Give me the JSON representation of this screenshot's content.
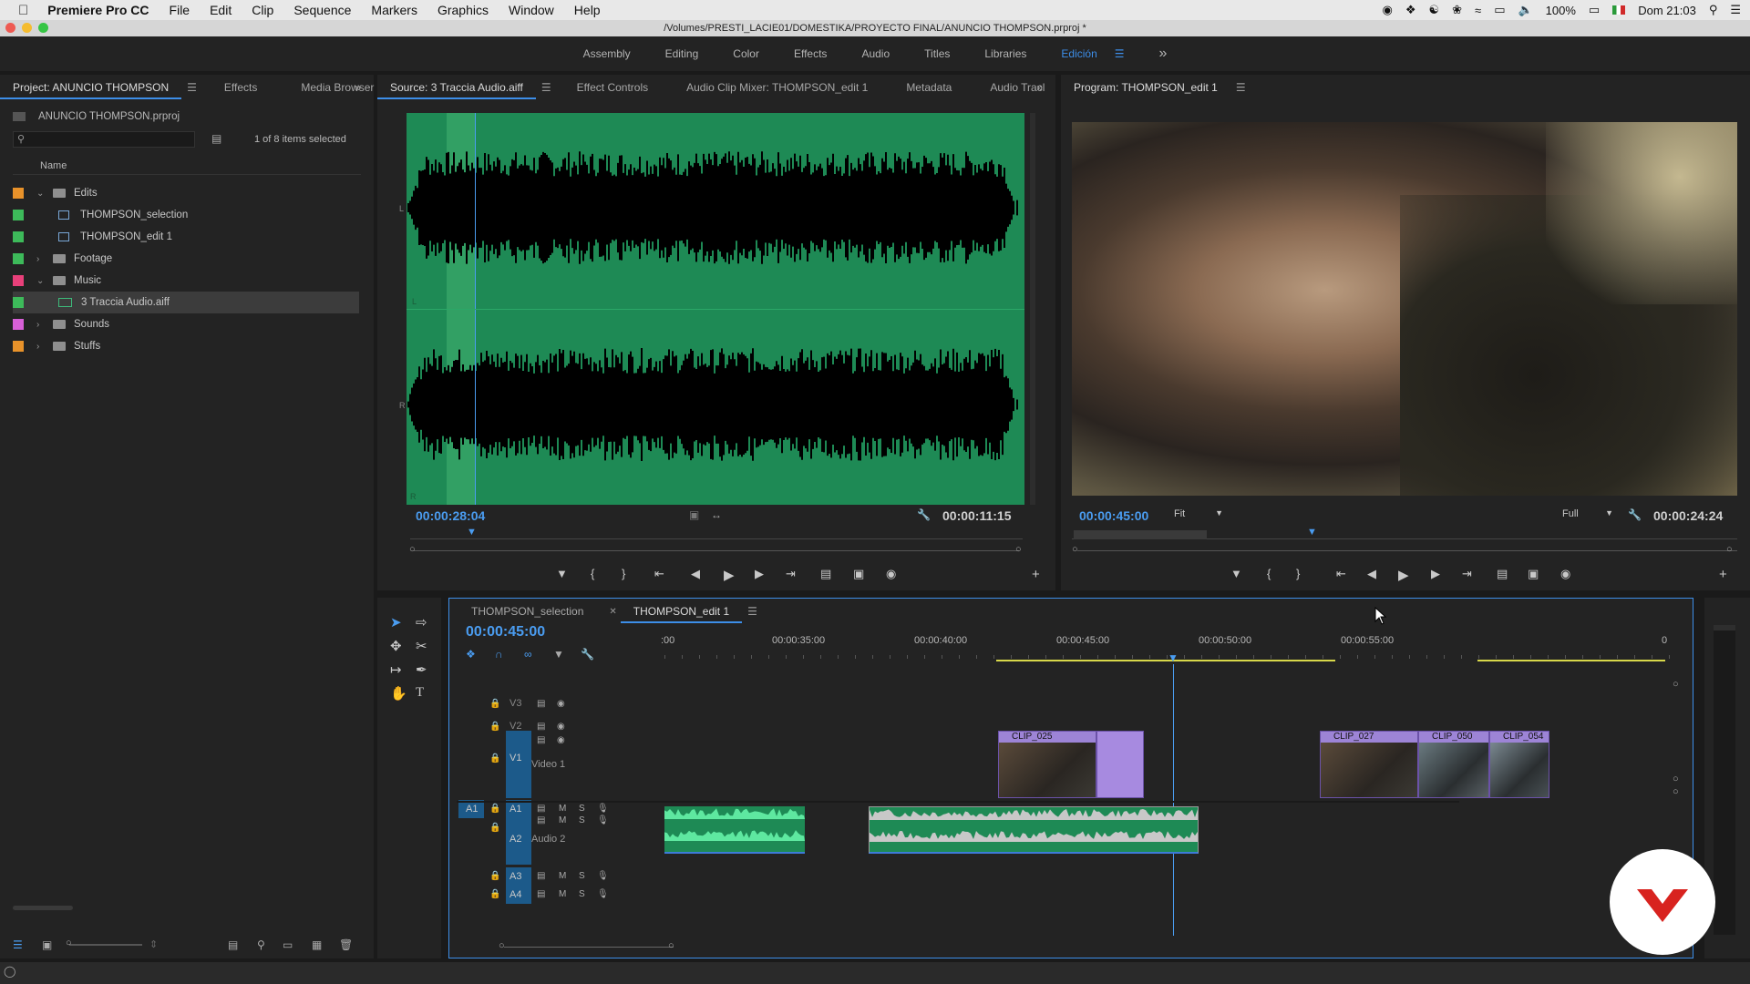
{
  "menubar": {
    "app_name": "Premiere Pro CC",
    "items": [
      "File",
      "Edit",
      "Clip",
      "Sequence",
      "Markers",
      "Graphics",
      "Window",
      "Help"
    ],
    "battery": "100%",
    "clock": "Dom 21:03"
  },
  "window": {
    "title": "/Volumes/PRESTI_LACIE01/DOMESTIKA/PROYECTO FINAL/ANUNCIO THOMPSON.prproj *"
  },
  "workspaces": {
    "items": [
      "Assembly",
      "Editing",
      "Color",
      "Effects",
      "Audio",
      "Titles",
      "Libraries",
      "Edición"
    ],
    "active": "Edición",
    "overflow": "»"
  },
  "project_panel": {
    "tabs": [
      "Project: ANUNCIO THOMPSON",
      "Effects",
      "Media Browser"
    ],
    "project_file": "ANUNCIO THOMPSON.prproj",
    "selection_status": "1 of 8 items selected",
    "column_name": "Name",
    "items": [
      {
        "label": "Edits",
        "type": "folder",
        "expanded": true,
        "color": "#e8922a",
        "indent": 0
      },
      {
        "label": "THOMPSON_selection",
        "type": "sequence",
        "color": "#3dba5a",
        "indent": 1
      },
      {
        "label": "THOMPSON_edit 1",
        "type": "sequence",
        "color": "#3dba5a",
        "indent": 1
      },
      {
        "label": "Footage",
        "type": "folder",
        "expanded": false,
        "color": "#3dba5a",
        "indent": 0
      },
      {
        "label": "Music",
        "type": "folder",
        "expanded": true,
        "color": "#e8407a",
        "indent": 0
      },
      {
        "label": "3 Traccia Audio.aiff",
        "type": "audio",
        "color": "#3dba5a",
        "indent": 1,
        "selected": true
      },
      {
        "label": "Sounds",
        "type": "folder",
        "expanded": false,
        "color": "#d860d8",
        "indent": 0
      },
      {
        "label": "Stuffs",
        "type": "folder",
        "expanded": false,
        "color": "#e8922a",
        "indent": 0
      }
    ]
  },
  "source_panel": {
    "tabs": [
      "Source: 3 Traccia Audio.aiff",
      "Effect Controls",
      "Audio Clip Mixer: THOMPSON_edit 1",
      "Metadata",
      "Audio Tracl"
    ],
    "timecode_current": "00:00:28:04",
    "timecode_duration": "00:00:11:15",
    "channel_labels": [
      "L",
      "L",
      "R",
      "R"
    ]
  },
  "program_panel": {
    "tab": "Program: THOMPSON_edit 1",
    "timecode_current": "00:00:45:00",
    "zoom": "Fit",
    "resolution": "Full",
    "timecode_duration": "00:00:24:24"
  },
  "timeline": {
    "tabs": [
      "THOMPSON_selection",
      "THOMPSON_edit 1"
    ],
    "active_tab": "THOMPSON_edit 1",
    "timecode": "00:00:45:00",
    "ruler": [
      "00:00:35:00",
      "00:00:40:00",
      "00:00:45:00",
      "00:00:50:00",
      "00:00:55:00"
    ],
    "ruler_start": ":00",
    "ruler_end": "0",
    "video_tracks": [
      {
        "id": "V3"
      },
      {
        "id": "V2"
      },
      {
        "id": "V1",
        "name": "Video 1"
      }
    ],
    "audio_tracks": [
      {
        "id": "A1",
        "source": "A1"
      },
      {
        "id": "A2",
        "name": "Audio 2"
      },
      {
        "id": "A3"
      },
      {
        "id": "A4"
      }
    ],
    "track_buttons": {
      "mute": "M",
      "solo": "S"
    },
    "clips": [
      {
        "name": "CLIP_025"
      },
      {
        "name": "CLIP_027"
      },
      {
        "name": "CLIP_050"
      },
      {
        "name": "CLIP_054"
      }
    ]
  },
  "colors": {
    "accent": "#3d8ee8",
    "waveform_bg": "#1e8a55",
    "clip_video": "#8b6fc9",
    "audio_clip": "#2e9e5e"
  }
}
